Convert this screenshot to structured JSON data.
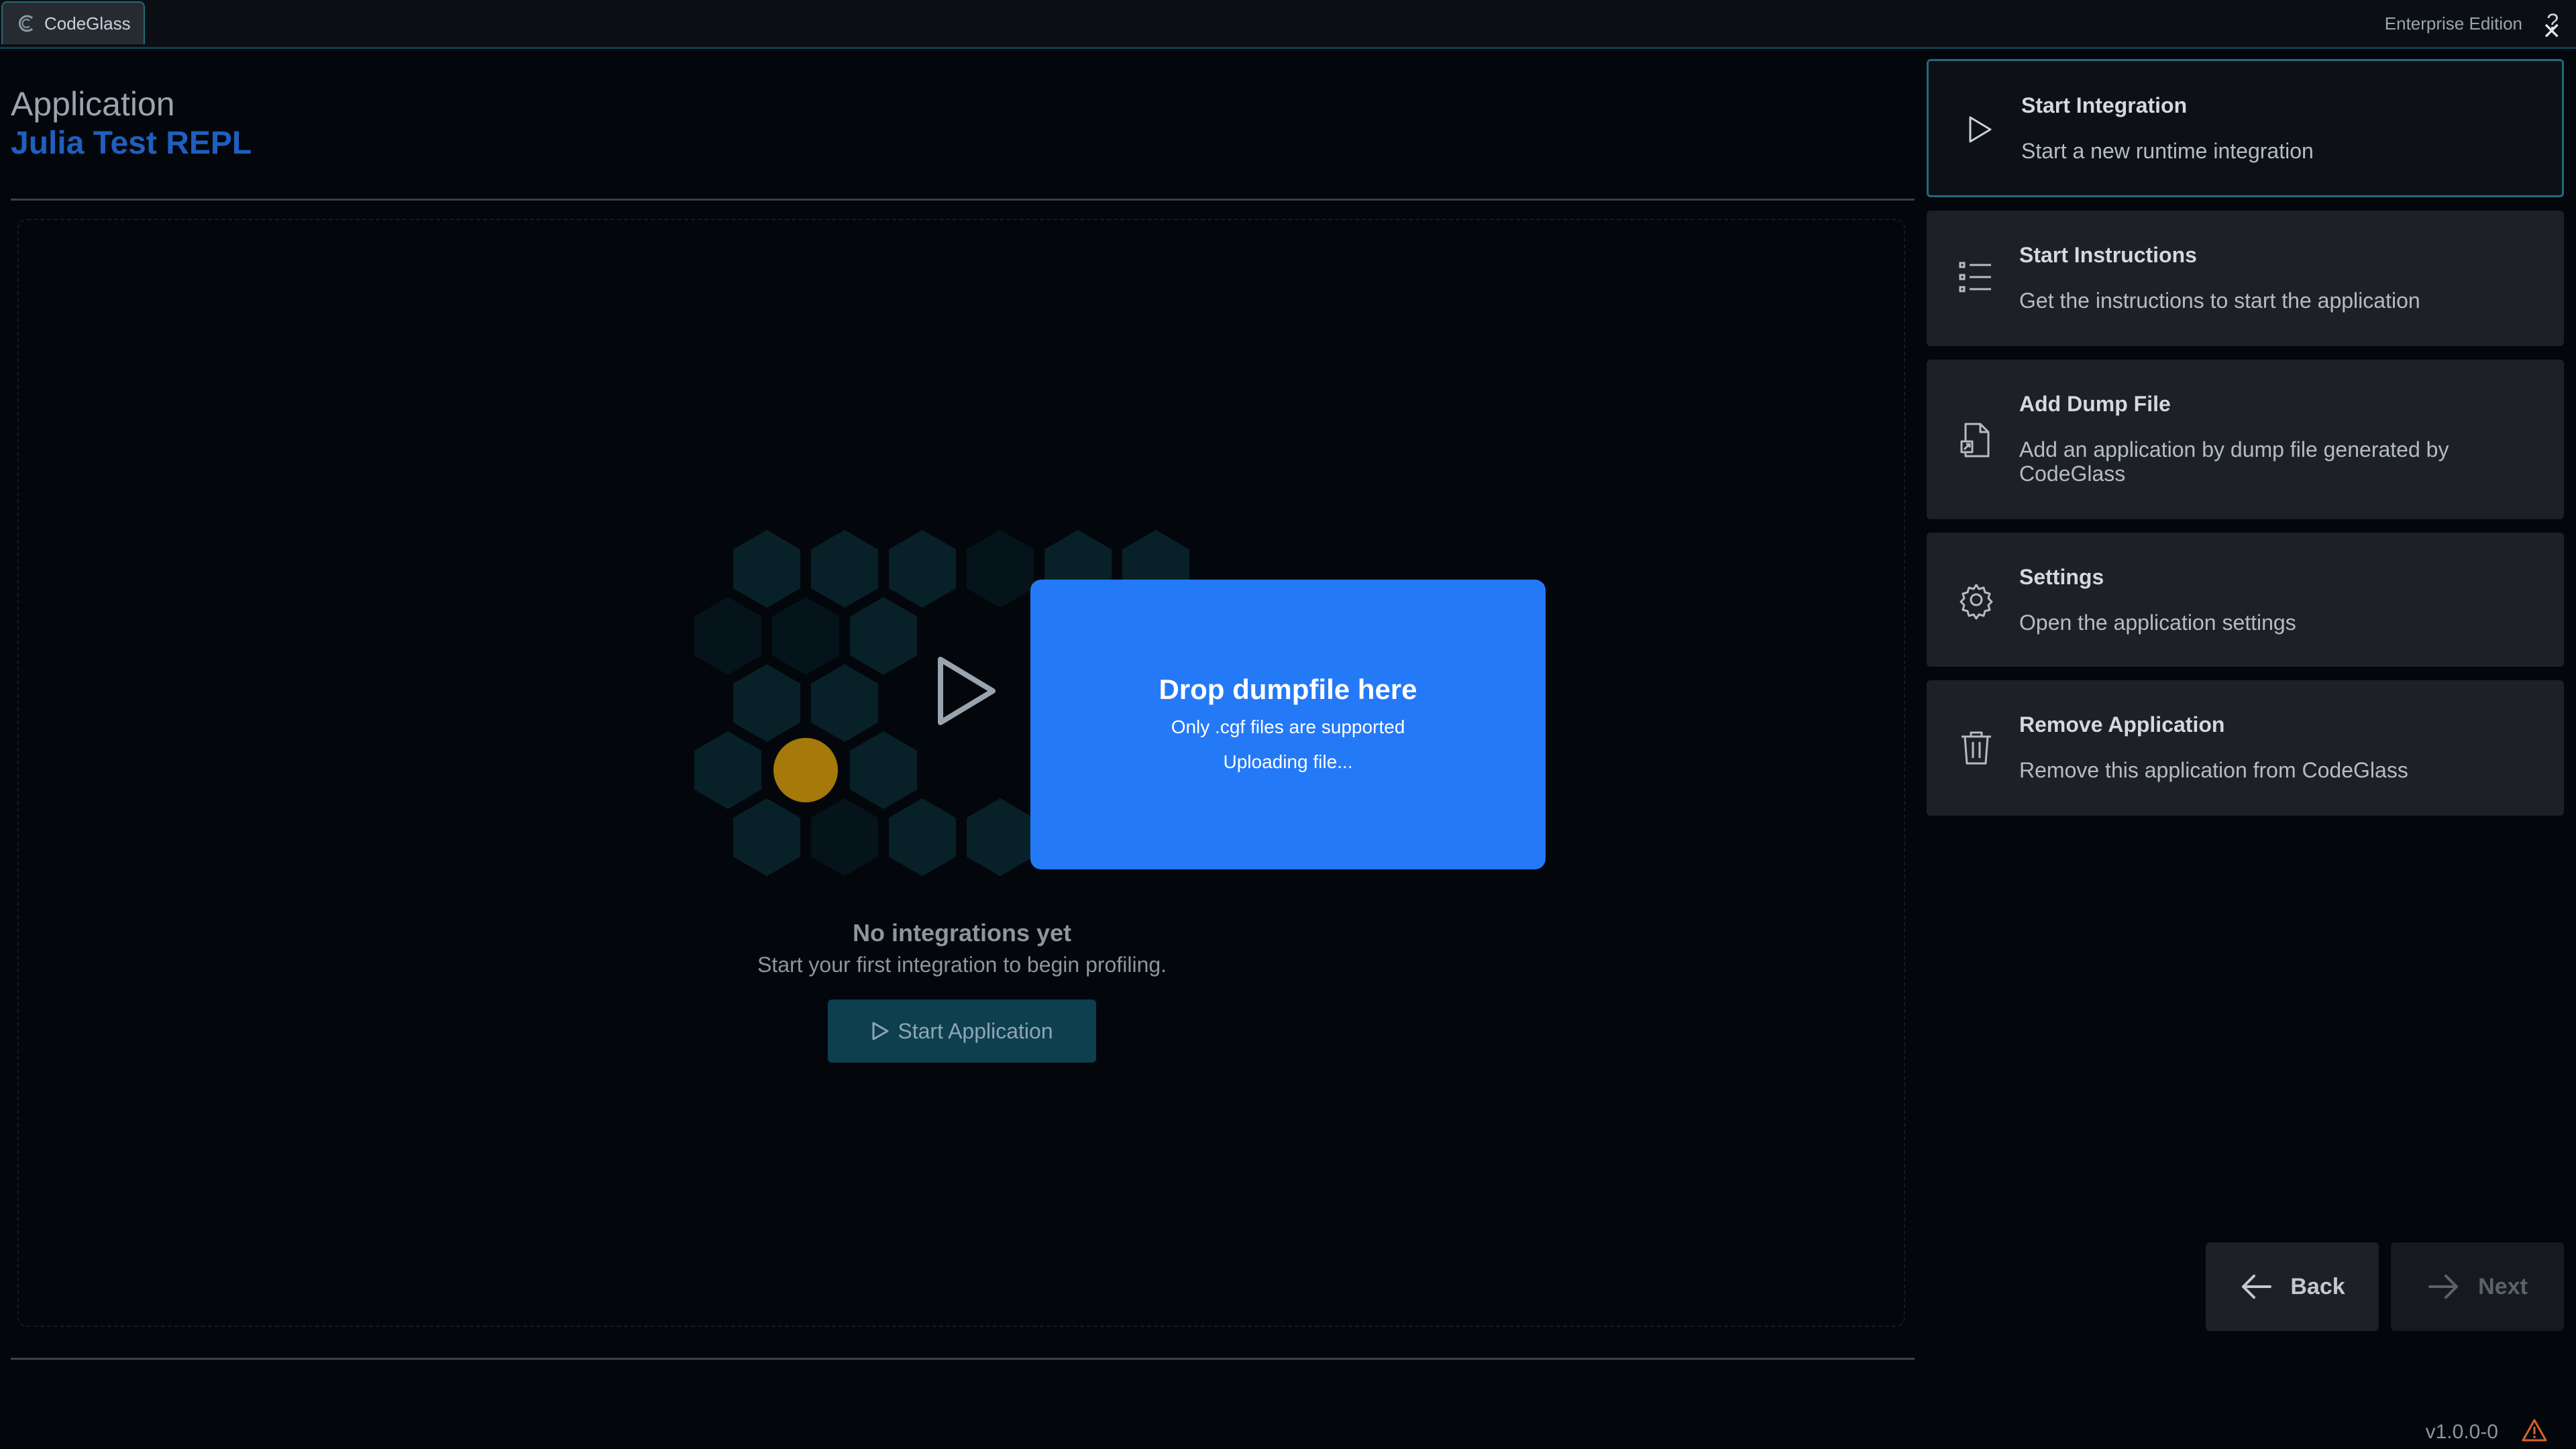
{
  "topbar": {
    "app_tab_label": "CodeGlass",
    "edition": "Enterprise Edition",
    "help_glyph": "?",
    "close_glyph": "✕"
  },
  "header": {
    "label": "Application",
    "app_name": "Julia Test REPL"
  },
  "empty_state": {
    "title": "No integrations yet",
    "subtitle": "Start your first integration to begin profiling.",
    "start_button": "Start Application"
  },
  "drop_overlay": {
    "title": "Drop dumpfile here",
    "subtitle": "Only .cgf files are supported",
    "status": "Uploading file..."
  },
  "actions": [
    {
      "title": "Start Integration",
      "desc": "Start a new runtime integration",
      "icon": "play-icon"
    },
    {
      "title": "Start Instructions",
      "desc": "Get the instructions to start the application",
      "icon": "list-icon"
    },
    {
      "title": "Add Dump File",
      "desc": "Add an application by dump file generated by CodeGlass",
      "icon": "file-icon"
    },
    {
      "title": "Settings",
      "desc": "Open the application settings",
      "icon": "gear-icon"
    },
    {
      "title": "Remove Application",
      "desc": "Remove this application from CodeGlass",
      "icon": "trash-icon"
    }
  ],
  "nav": {
    "back": "Back",
    "next": "Next"
  },
  "footer": {
    "version": "v1.0.0-0"
  },
  "colors": {
    "accent": "#2479f7",
    "brand_teal": "#1f6b7a",
    "app_name": "#1f5fbf",
    "highlight_hex": "#b8860b"
  }
}
